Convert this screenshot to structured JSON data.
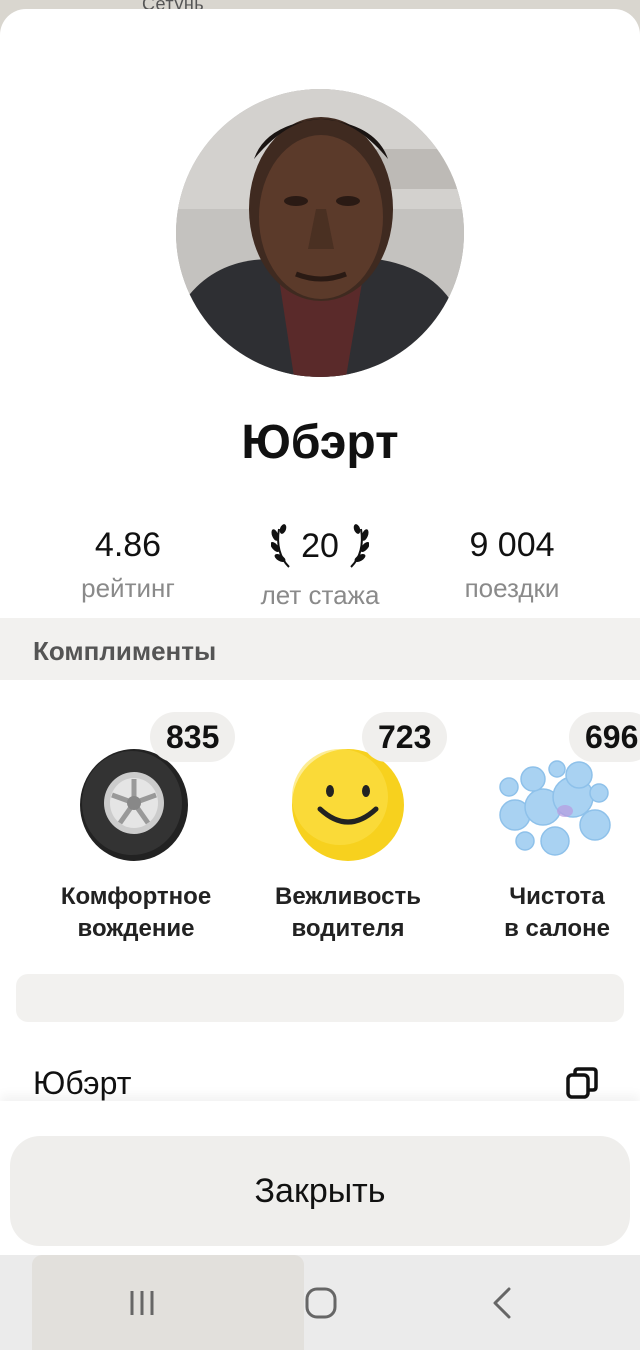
{
  "map": {
    "label": "Сетунь"
  },
  "driver": {
    "name": "Юбэрт"
  },
  "stats": {
    "rating": {
      "value": "4.86",
      "label": "рейтинг"
    },
    "experience": {
      "value": "20",
      "label": "лет стажа"
    },
    "trips": {
      "value": "9 004",
      "label": "поездки"
    }
  },
  "compliments": {
    "title": "Комплименты",
    "items": [
      {
        "count": "835",
        "line1": "Комфортное",
        "line2": "вождение",
        "icon": "tire-icon"
      },
      {
        "count": "723",
        "line1": "Вежливость",
        "line2": "водителя",
        "icon": "smiley-icon"
      },
      {
        "count": "696",
        "line1": "Чистота",
        "line2": "в салоне",
        "icon": "bubbles-icon"
      }
    ]
  },
  "name_row": {
    "text": "Юбэрт",
    "icon": "copy-icon"
  },
  "actions": {
    "close_label": "Закрыть"
  },
  "navigation": {
    "icons": [
      "recent-apps-icon",
      "home-icon",
      "back-icon"
    ]
  },
  "colors": {
    "background": "#ffffff",
    "section_bg": "#f2f1ef",
    "muted_text": "#8a8a8a",
    "smiley": "#f7d11e"
  }
}
